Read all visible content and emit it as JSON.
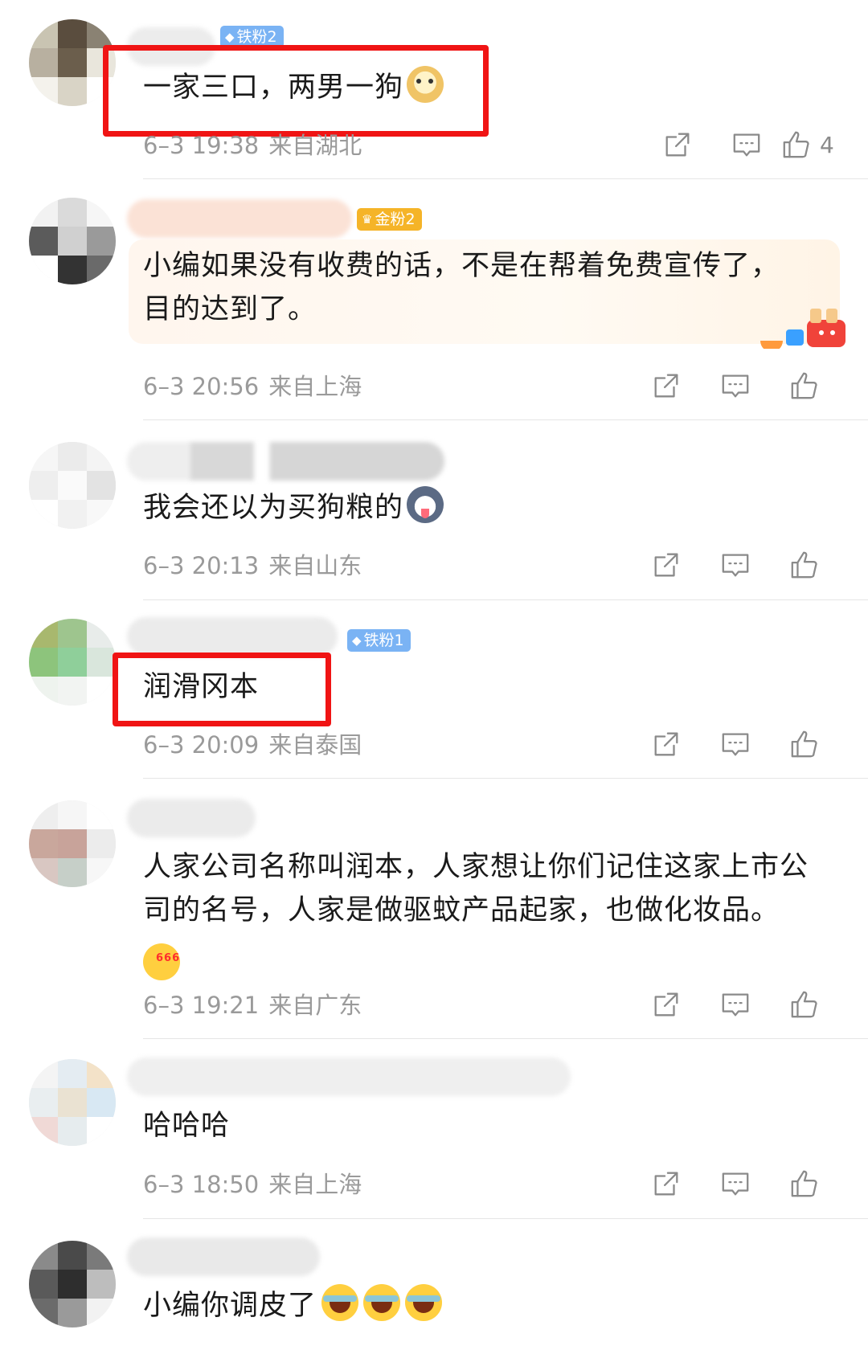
{
  "comments": [
    {
      "badge": "铁粉2",
      "text": "一家三口，两男一狗",
      "emoji": "doge-emoji",
      "date": "6–3 19:38",
      "location": "来自湖北",
      "likes": "4"
    },
    {
      "badge": "金粉2",
      "text": "小编如果没有收费的话，不是在帮着免费宣传了，目的达到了。",
      "date": "6–3 20:56",
      "location": "来自上海"
    },
    {
      "text": "我会还以为买狗粮的",
      "emoji": "husky-emoji",
      "date": "6–3 20:13",
      "location": "来自山东"
    },
    {
      "badge": "铁粉1",
      "text": "润滑冈本",
      "date": "6–3 20:09",
      "location": "来自泰国"
    },
    {
      "text": "人家公司名称叫润本，人家想让你们记住这家上市公司的名号，人家是做驱蚊产品起家，也做化妆品。",
      "emoji": "666-emoji",
      "date": "6–3 19:21",
      "location": "来自广东"
    },
    {
      "text": "哈哈哈",
      "date": "6–3 18:50",
      "location": "来自上海"
    },
    {
      "text": "小编你调皮了",
      "emoji": "laugh-cry-emoji"
    }
  ],
  "icons": {
    "share": "share-icon",
    "reply": "comment-icon",
    "like": "thumbs-up-icon"
  },
  "colors": {
    "highlight_box": "#f01414",
    "iron_badge": "#7ab3f4",
    "gold_badge": "#f5b428",
    "meta_text": "#9a9a9a"
  }
}
